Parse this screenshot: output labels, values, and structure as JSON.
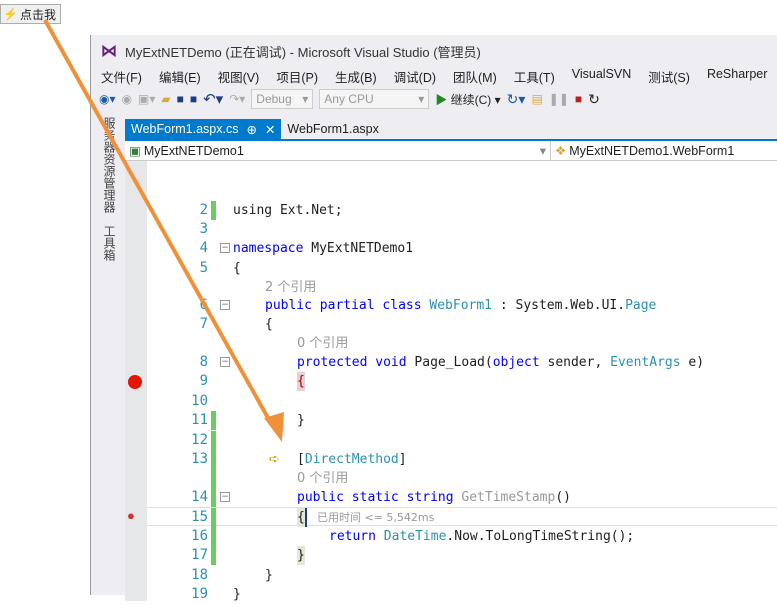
{
  "button": {
    "label": "点击我"
  },
  "window": {
    "title": "MyExtNETDemo (正在调试) - Microsoft Visual Studio (管理员)"
  },
  "menu": [
    "文件(F)",
    "编辑(E)",
    "视图(V)",
    "项目(P)",
    "生成(B)",
    "调试(D)",
    "团队(M)",
    "工具(T)",
    "VisualSVN",
    "测试(S)",
    "ReSharper"
  ],
  "toolbar": {
    "config": "Debug",
    "platform": "Any CPU",
    "continue": "继续(C)"
  },
  "side_tabs": [
    "服务器资源管理器",
    "工具箱"
  ],
  "tabs": [
    {
      "label": "WebForm1.aspx.cs",
      "active": true
    },
    {
      "label": "WebForm1.aspx",
      "active": false
    }
  ],
  "nav": {
    "project": "MyExtNETDemo1",
    "class": "MyExtNETDemo1.WebForm1"
  },
  "code": {
    "l2": "using Ext.Net;",
    "ns_kw": "namespace",
    "ns": "MyExtNETDemo1",
    "ref2": "2 个引用",
    "ref0": "0 个引用",
    "pub": "public",
    "partial": "partial",
    "class": "class",
    "cls": "WebForm1",
    "page": "System.Web.UI.",
    "pagetype": "Page",
    "protected": "protected",
    "void": "void",
    "pageload": "Page_Load(",
    "object": "object",
    "sender": " sender, ",
    "eventargs": "EventArgs",
    "e": " e)",
    "attr": "DirectMethod",
    "static": "static",
    "string": "string",
    "method": "GetTimeStamp",
    "ret": "return",
    "dt": "DateTime",
    "rest": ".Now.ToLongTimeString();",
    "perf": "已用时间 <= 5,542ms"
  },
  "line_numbers": [
    "2",
    "3",
    "4",
    "5",
    "6",
    "7",
    "8",
    "9",
    "10",
    "11",
    "12",
    "13",
    "14",
    "15",
    "16",
    "17",
    "18",
    "19"
  ],
  "colors": {
    "accent": "#007acc",
    "arrow": "#f0913a",
    "breakpoint": "#e51400"
  }
}
